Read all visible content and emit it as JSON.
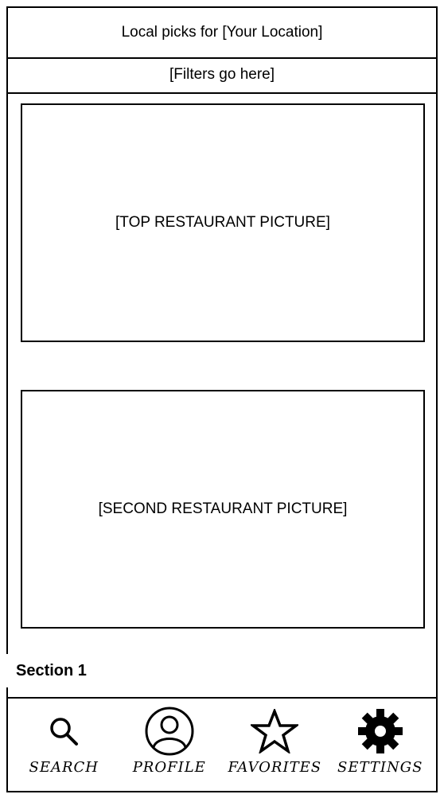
{
  "header": {
    "title": "Local picks for [Your Location]"
  },
  "filters": {
    "label": "[Filters go here]"
  },
  "cards": [
    {
      "label": "[TOP RESTAURANT PICTURE]"
    },
    {
      "label": "[SECOND RESTAURANT PICTURE]"
    }
  ],
  "section": {
    "label": "Section 1"
  },
  "nav": {
    "items": [
      {
        "label": "SEARCH",
        "icon": "search-icon"
      },
      {
        "label": "PROFILE",
        "icon": "profile-icon"
      },
      {
        "label": "FAVORITES",
        "icon": "star-icon"
      },
      {
        "label": "SETTINGS",
        "icon": "gear-icon"
      }
    ]
  }
}
